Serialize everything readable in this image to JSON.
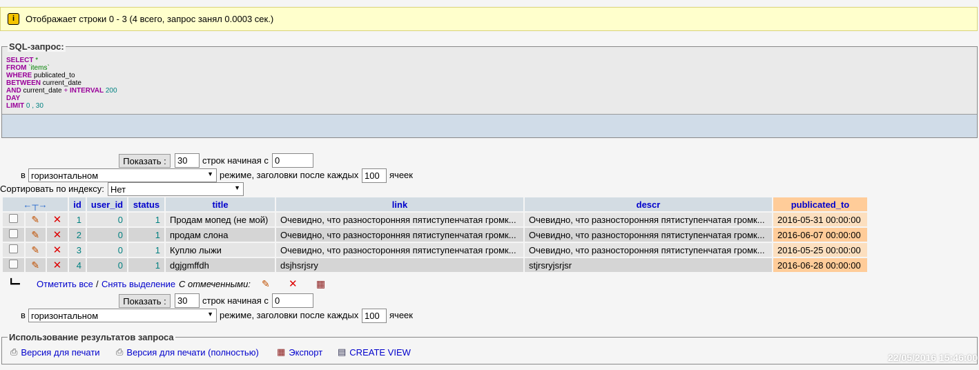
{
  "notice": {
    "text": "Отображает строки 0 - 3 (4 всего, запрос занял 0.0003 сек.)"
  },
  "sql": {
    "legend": "SQL-запрос:",
    "lines": [
      [
        {
          "t": "SELECT",
          "c": "kw"
        },
        {
          "t": " *",
          "c": "str"
        }
      ],
      [
        {
          "t": "FROM",
          "c": "kw"
        },
        {
          "t": " `items`",
          "c": "str"
        }
      ],
      [
        {
          "t": "WHERE",
          "c": "kw"
        },
        {
          "t": " publicated_to",
          "c": ""
        }
      ],
      [
        {
          "t": "BETWEEN",
          "c": "kw"
        },
        {
          "t": " current_date",
          "c": ""
        }
      ],
      [
        {
          "t": "AND",
          "c": "kw"
        },
        {
          "t": " current_date ",
          "c": ""
        },
        {
          "t": "+",
          "c": "kw-plain"
        },
        {
          "t": " INTERVAL",
          "c": "kw"
        },
        {
          "t": " 200",
          "c": "num"
        }
      ],
      [
        {
          "t": "DAY",
          "c": "kw"
        }
      ],
      [
        {
          "t": "LIMIT",
          "c": "kw"
        },
        {
          "t": " 0 , 30",
          "c": "num"
        }
      ]
    ]
  },
  "nav": {
    "show_button": "Показать :",
    "rows_value": "30",
    "rows_label": "строк начиная с",
    "start_value": "0",
    "in_label": "в",
    "mode_value": "горизонтальном",
    "mode_label": "режиме, заголовки после каждых",
    "repeat_value": "100",
    "cells_label": "ячеек"
  },
  "sort": {
    "label": "Сортировать по индексу:",
    "value": "Нет"
  },
  "table": {
    "columns": [
      "id",
      "user_id",
      "status",
      "title",
      "link",
      "descr",
      "publicated_to"
    ],
    "rows": [
      {
        "id": "1",
        "user_id": "0",
        "status": "1",
        "title": "Продам мопед (не мой)",
        "link": "Очевидно, что разносторонняя пятиступенчатая громк...",
        "descr": "Очевидно, что разносторонняя пятиступенчатая громк...",
        "publicated_to": "2016-05-31 00:00:00"
      },
      {
        "id": "2",
        "user_id": "0",
        "status": "1",
        "title": "продам слона",
        "link": "Очевидно, что разносторонняя пятиступенчатая громк...",
        "descr": "Очевидно, что разносторонняя пятиступенчатая громк...",
        "publicated_to": "2016-06-07 00:00:00"
      },
      {
        "id": "3",
        "user_id": "0",
        "status": "1",
        "title": "Куплю лыжи",
        "link": "Очевидно, что разносторонняя пятиступенчатая громк...",
        "descr": "Очевидно, что разносторонняя пятиступенчатая громк...",
        "publicated_to": "2016-05-25 00:00:00"
      },
      {
        "id": "4",
        "user_id": "0",
        "status": "1",
        "title": "dgjgmffdh",
        "link": "dsjhsrjsry",
        "descr": "stjrsryjsrjsr",
        "publicated_to": "2016-06-28 00:00:00"
      }
    ]
  },
  "selection": {
    "check_all": "Отметить все",
    "separator": "/",
    "uncheck_all": "Снять выделение",
    "with_selected": "С отмеченными:"
  },
  "ops": {
    "legend": "Использование результатов запроса",
    "print": "Версия для печати",
    "print_full": "Версия для печати (полностью)",
    "export": "Экспорт",
    "create_view": "CREATE VIEW"
  },
  "timestamp": "22/05/2016 15:46:00",
  "colors": {
    "notice_bg": "#ffffcc",
    "header_bg": "#d3dce3",
    "sorted_bg": "#ffcc99",
    "link": "#0000cc"
  }
}
